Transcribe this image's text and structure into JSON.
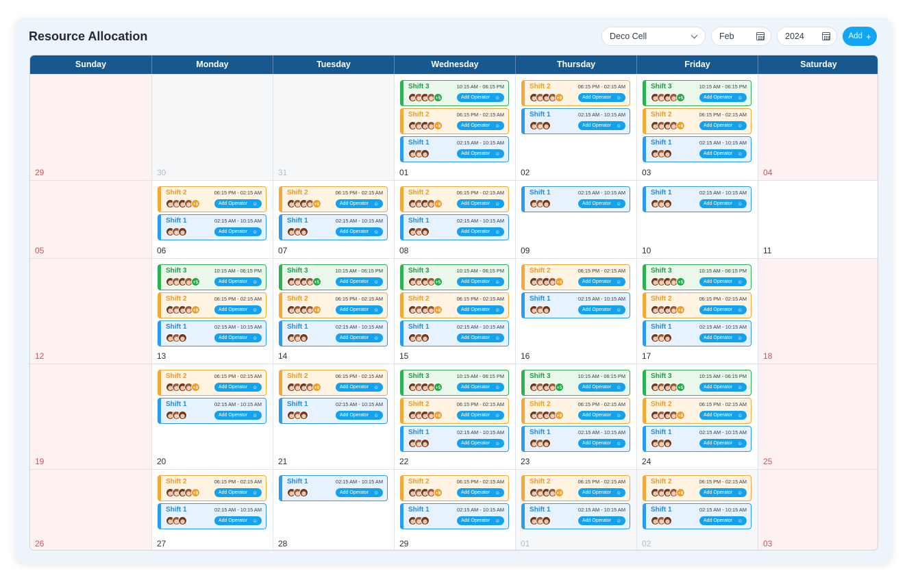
{
  "title": "Resource Allocation",
  "toolbar": {
    "cell": "Deco Cell",
    "month": "Feb",
    "year": "2024",
    "add_label": "Add",
    "add_icon": "+"
  },
  "weekdays": [
    "Sunday",
    "Monday",
    "Tuesday",
    "Wednesday",
    "Thursday",
    "Friday",
    "Saturday"
  ],
  "shift_defs": {
    "s3": {
      "name": "Shift 3",
      "time": "10:15 AM - 06:15 PM",
      "more": "+5"
    },
    "s2": {
      "name": "Shift 2",
      "time": "06:15 PM - 02:15 AM",
      "more": "+8"
    },
    "s1": {
      "name": "Shift 1",
      "time": "02:15 AM - 10:15 AM",
      "more": ""
    }
  },
  "add_operator_label": "Add Operator",
  "colors": {
    "header": "#17598f",
    "shift3": "#2fb052",
    "shift2": "#f5a737",
    "shift1": "#2c9bef",
    "accent": "#12a5f1",
    "weekend": "#fdf1f1"
  },
  "icons": {
    "dropdown": "chevron-down-icon",
    "calendar": "calendar-icon",
    "add": "plus-icon",
    "add_operator": "user-add-icon"
  },
  "weeks": [
    [
      {
        "day": "29",
        "kind": "weekend",
        "shifts": []
      },
      {
        "day": "30",
        "kind": "muted",
        "shifts": []
      },
      {
        "day": "31",
        "kind": "muted",
        "shifts": []
      },
      {
        "day": "01",
        "kind": "normal",
        "shifts": [
          "s3",
          "s2",
          "s1"
        ]
      },
      {
        "day": "02",
        "kind": "normal",
        "shifts": [
          "s2",
          "s1"
        ]
      },
      {
        "day": "03",
        "kind": "normal",
        "shifts": [
          "s3",
          "s2",
          "s1"
        ]
      },
      {
        "day": "04",
        "kind": "weekend",
        "shifts": []
      }
    ],
    [
      {
        "day": "05",
        "kind": "weekend",
        "shifts": []
      },
      {
        "day": "06",
        "kind": "normal",
        "shifts": [
          "s2",
          "s1"
        ]
      },
      {
        "day": "07",
        "kind": "normal",
        "shifts": [
          "s2",
          "s1"
        ]
      },
      {
        "day": "08",
        "kind": "normal",
        "shifts": [
          "s2",
          "s1"
        ]
      },
      {
        "day": "09",
        "kind": "normal",
        "shifts": [
          "s1"
        ]
      },
      {
        "day": "10",
        "kind": "normal",
        "shifts": [
          "s1"
        ]
      },
      {
        "day": "11",
        "kind": "normal",
        "shifts": []
      }
    ],
    [
      {
        "day": "12",
        "kind": "weekend",
        "shifts": []
      },
      {
        "day": "13",
        "kind": "normal",
        "shifts": [
          "s3",
          "s2",
          "s1"
        ]
      },
      {
        "day": "14",
        "kind": "normal",
        "shifts": [
          "s3",
          "s2",
          "s1"
        ]
      },
      {
        "day": "15",
        "kind": "normal",
        "shifts": [
          "s3",
          "s2",
          "s1"
        ]
      },
      {
        "day": "16",
        "kind": "normal",
        "shifts": [
          "s2",
          "s1"
        ]
      },
      {
        "day": "17",
        "kind": "normal",
        "shifts": [
          "s3",
          "s2",
          "s1"
        ]
      },
      {
        "day": "18",
        "kind": "weekend",
        "shifts": []
      }
    ],
    [
      {
        "day": "19",
        "kind": "weekend",
        "shifts": []
      },
      {
        "day": "20",
        "kind": "normal",
        "shifts": [
          "s2",
          "s1"
        ]
      },
      {
        "day": "21",
        "kind": "normal",
        "shifts": [
          "s2",
          "s1"
        ]
      },
      {
        "day": "22",
        "kind": "normal",
        "shifts": [
          "s3",
          "s2",
          "s1"
        ]
      },
      {
        "day": "23",
        "kind": "normal",
        "shifts": [
          "s3",
          "s2",
          "s1"
        ]
      },
      {
        "day": "24",
        "kind": "normal",
        "shifts": [
          "s3",
          "s2",
          "s1"
        ]
      },
      {
        "day": "25",
        "kind": "weekend",
        "shifts": []
      }
    ],
    [
      {
        "day": "26",
        "kind": "weekend",
        "shifts": []
      },
      {
        "day": "27",
        "kind": "normal",
        "shifts": [
          "s2",
          "s1"
        ]
      },
      {
        "day": "28",
        "kind": "normal",
        "shifts": [
          "s1"
        ]
      },
      {
        "day": "29",
        "kind": "normal",
        "shifts": [
          "s2",
          "s1"
        ]
      },
      {
        "day": "01",
        "kind": "muted",
        "shifts": [
          "s2",
          "s1"
        ]
      },
      {
        "day": "02",
        "kind": "muted",
        "shifts": [
          "s2",
          "s1"
        ]
      },
      {
        "day": "03",
        "kind": "weekend",
        "shifts": []
      }
    ]
  ]
}
